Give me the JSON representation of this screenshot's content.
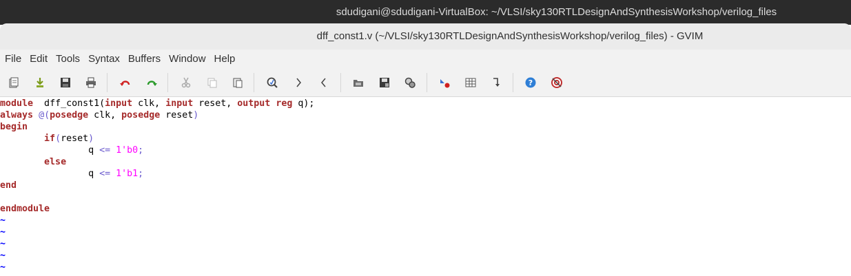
{
  "system_bar": {
    "title": "sdudigani@sdudigani-VirtualBox: ~/VLSI/sky130RTLDesignAndSynthesisWorkshop/verilog_files"
  },
  "window": {
    "title": "dff_const1.v (~/VLSI/sky130RTLDesignAndSynthesisWorkshop/verilog_files) - GVIM"
  },
  "menu": [
    "File",
    "Edit",
    "Tools",
    "Syntax",
    "Buffers",
    "Window",
    "Help"
  ],
  "toolbar": {
    "icons": [
      "open-file-icon",
      "save-down-icon",
      "save-icon",
      "print-icon",
      "undo-icon",
      "redo-icon",
      "cut-icon",
      "copy-icon",
      "paste-icon",
      "find-replace-icon",
      "find-next-icon",
      "find-prev-icon",
      "load-session-icon",
      "save-session-icon",
      "run-script-icon",
      "make-icon",
      "shell-icon",
      "tags-jump-icon",
      "help-icon",
      "find-help-icon"
    ]
  },
  "editor": {
    "lines": [
      [
        [
          "kw",
          "module"
        ],
        [
          "",
          "  dff_const1("
        ],
        [
          "kw",
          "input"
        ],
        [
          "",
          " clk, "
        ],
        [
          "kw",
          "input"
        ],
        [
          "",
          " reset, "
        ],
        [
          "kw",
          "output"
        ],
        [
          "",
          " "
        ],
        [
          "kw",
          "reg"
        ],
        [
          "",
          " q);"
        ]
      ],
      [
        [
          "kw",
          "always"
        ],
        [
          "",
          " "
        ],
        [
          "op",
          "@("
        ],
        [
          "kw",
          "posedge"
        ],
        [
          "",
          " clk, "
        ],
        [
          "kw",
          "posedge"
        ],
        [
          "",
          " reset"
        ],
        [
          "op",
          ")"
        ]
      ],
      [
        [
          "kw",
          "begin"
        ]
      ],
      [
        [
          "",
          "        "
        ],
        [
          "kw",
          "if"
        ],
        [
          "op",
          "("
        ],
        [
          "",
          "reset"
        ],
        [
          "op",
          ")"
        ]
      ],
      [
        [
          "",
          "                q "
        ],
        [
          "op",
          "<="
        ],
        [
          "",
          " "
        ],
        [
          "num",
          "1'b0"
        ],
        [
          "op",
          ";"
        ]
      ],
      [
        [
          "",
          "        "
        ],
        [
          "kw",
          "else"
        ]
      ],
      [
        [
          "",
          "                q "
        ],
        [
          "op",
          "<="
        ],
        [
          "",
          " "
        ],
        [
          "num",
          "1'b1"
        ],
        [
          "op",
          ";"
        ]
      ],
      [
        [
          "kw",
          "end"
        ]
      ],
      [],
      [
        [
          "kw",
          "endmodule"
        ]
      ]
    ],
    "tilde_lines": [
      "~",
      "~",
      "~",
      "~",
      "~"
    ]
  },
  "colors": {
    "keyword": "#a52a2a",
    "operator": "#6a5acd",
    "number": "#ff00ff",
    "tilde": "#0000ff"
  }
}
